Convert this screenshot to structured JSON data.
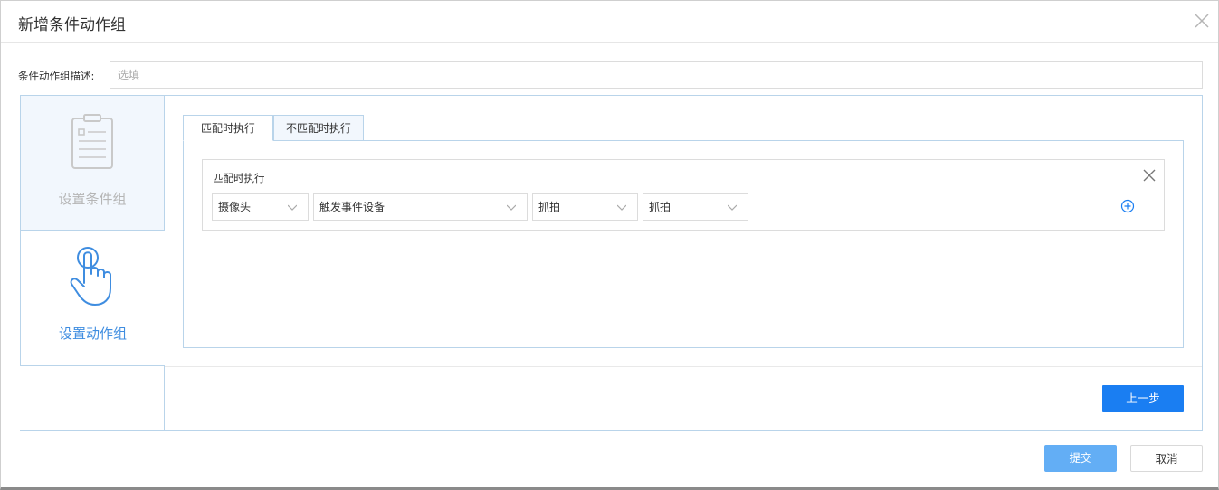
{
  "dialog": {
    "title": "新增条件动作组"
  },
  "description": {
    "label": "条件动作组描述:",
    "placeholder": "选填",
    "value": ""
  },
  "steps": [
    {
      "label": "设置条件组",
      "icon": "clipboard-icon",
      "active": false
    },
    {
      "label": "设置动作组",
      "icon": "hand-pointer-icon",
      "active": true
    }
  ],
  "tabs": [
    {
      "label": "匹配时执行",
      "active": true
    },
    {
      "label": "不匹配时执行",
      "active": false
    }
  ],
  "rule": {
    "title": "匹配时执行",
    "selects": [
      {
        "value": "摄像头"
      },
      {
        "value": "触发事件设备"
      },
      {
        "value": "抓拍"
      },
      {
        "value": "抓拍"
      }
    ]
  },
  "buttons": {
    "prev": "上一步",
    "submit": "提交",
    "cancel": "取消"
  },
  "colors": {
    "primary": "#1a7ef2",
    "submit": "#63aef5",
    "active_step_text": "#3f8de0",
    "border": "#b9d4ea"
  }
}
